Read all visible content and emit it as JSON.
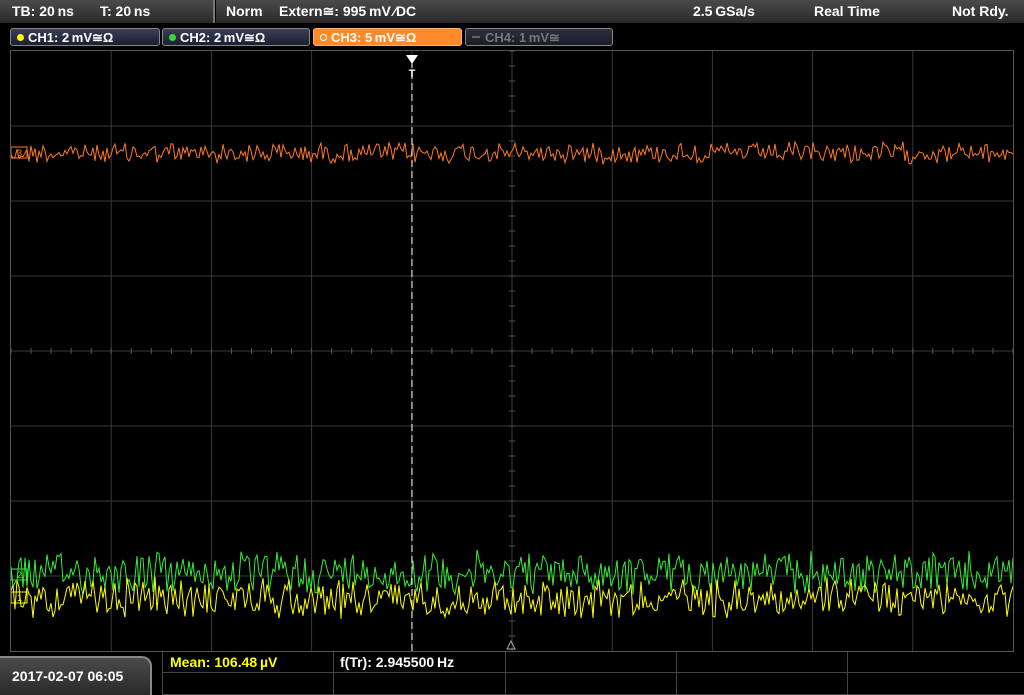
{
  "topbar": {
    "timebase": "TB: 20 ns",
    "trigger_time": "T: 20 ns",
    "trigger_mode": "Norm",
    "trigger_source": "Extern≅: 995 mV ∕DC",
    "sample_rate": "2.5 GSa/s",
    "acq_mode": "Real Time",
    "status": "Not Rdy."
  },
  "channels": [
    {
      "label": "CH1: 2 mV≅Ω",
      "color": "#ffff00"
    },
    {
      "label": "CH2: 2 mV≅Ω",
      "color": "#33dd33"
    },
    {
      "label": "CH3: 5 mV≅Ω",
      "color": "#ff7a20"
    },
    {
      "label": "CH4: 1 mV≅",
      "color": "#888888"
    }
  ],
  "markers": {
    "trigger": "T",
    "ch3_ref": "3",
    "ch2_ref": "2",
    "ch1_ref": "1"
  },
  "bottom": {
    "datetime": "2017-02-07 06:05",
    "mean": "Mean: 106.48 µV",
    "freq": "f(Tr): 2.945500 Hz"
  },
  "colors": {
    "ch1": "#ffff00",
    "ch2": "#33ee33",
    "ch3": "#ff7a20",
    "grid": "#3a3a3a",
    "accent_meas": "#ffff00"
  }
}
